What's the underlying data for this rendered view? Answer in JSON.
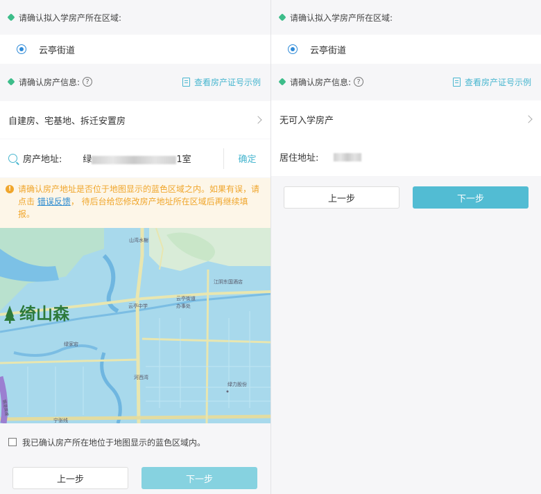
{
  "left": {
    "region_header": "请确认拟入学房产所在区域:",
    "region_option": "云亭街道",
    "property_header": "请确认房产信息:",
    "help_glyph": "?",
    "example_link": "查看房产证号示例",
    "property_type": "自建房、宅基地、拆迁安置房",
    "address_label": "房产地址:",
    "address_prefix": "绿",
    "address_suffix": "1室",
    "confirm_label": "确定",
    "warning": {
      "icon": "!",
      "text1": "请确认房产地址是否位于地图显示的蓝色区域之内。如果有误，请点击 ",
      "link": "错误反馈",
      "text2": "， 待后台给您修改房产地址所在区域后再继续填报。"
    },
    "map_labels": {
      "l1": "山湾水榭",
      "l2": "江阴东国酒店",
      "l3": "云亭中学",
      "l4": "云亭街道",
      "l5": "办事处",
      "l6": "绿家宕",
      "l7": "河西湾",
      "l8": "绿力股份",
      "l9": "宁张线",
      "l10": "绮山森",
      "l11": "锡澄高速"
    },
    "checkbox_label": "我已确认房产所在地位于地图显示的蓝色区域内。",
    "prev_label": "上一步",
    "next_label": "下一步"
  },
  "right": {
    "region_header": "请确认拟入学房产所在区域:",
    "region_option": "云亭街道",
    "property_header": "请确认房产信息:",
    "help_glyph": "?",
    "example_link": "查看房产证号示例",
    "property_type": "无可入学房产",
    "residence_label": "居住地址:",
    "prev_label": "上一步",
    "next_label": "下一步"
  },
  "colors": {
    "accent": "#48b6cf",
    "primary_button": "#52bcd3",
    "warning": "#f0a62c",
    "radio": "#2e8ad8"
  }
}
